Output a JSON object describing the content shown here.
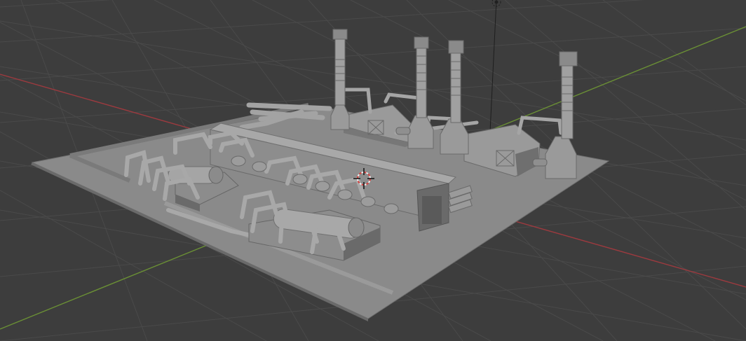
{
  "app": "3D Viewport",
  "scene": {
    "object": "industrial-plant-model",
    "shading": "solid",
    "stacks": 4,
    "generator_units": 2,
    "tanks": 2
  },
  "colors": {
    "background": "#3d3d3d",
    "grid": "#4a4a4a",
    "x_axis": "#9c3a3f",
    "y_axis": "#6a8f35",
    "model_light": "#9a9a9a",
    "model_mid": "#808080",
    "model_dark": "#5f5f5f",
    "cursor_red": "#d6413f"
  },
  "icons": [
    "3d-cursor-icon",
    "light-icon"
  ]
}
